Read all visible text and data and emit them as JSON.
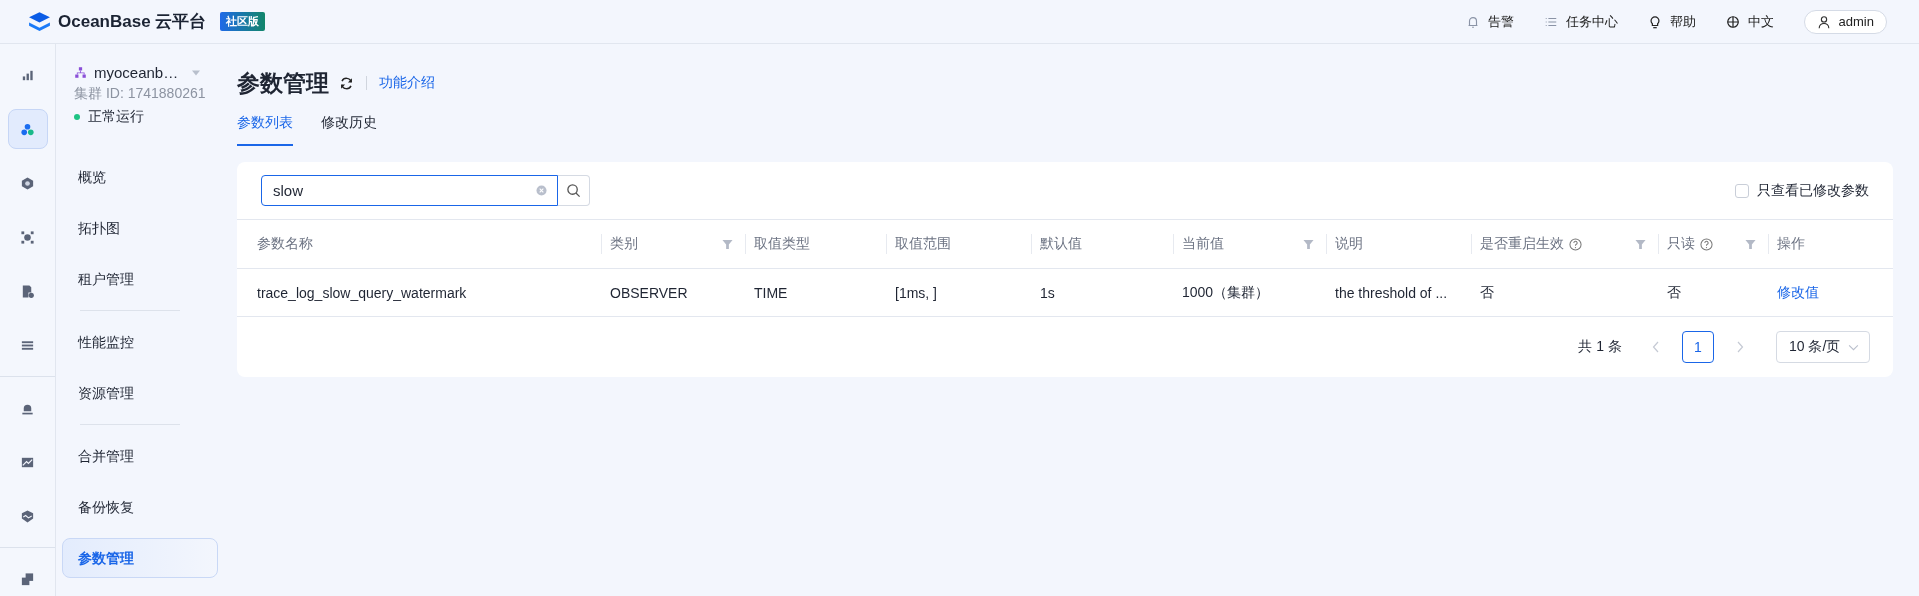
{
  "header": {
    "brand": "OceanBase 云平台",
    "edition": "社区版",
    "actions": [
      {
        "kind": "bell",
        "label": "告警"
      },
      {
        "kind": "list",
        "label": "任务中心"
      },
      {
        "kind": "bulb",
        "label": "帮助"
      },
      {
        "kind": "globe",
        "label": "中文"
      }
    ],
    "user": "admin"
  },
  "rail": [
    {
      "kind": "bars",
      "selected": false,
      "divider_before": false
    },
    {
      "kind": "cluster",
      "selected": true,
      "divider_before": false
    },
    {
      "kind": "hexagon",
      "selected": false,
      "divider_before": false
    },
    {
      "kind": "nodes",
      "selected": false,
      "divider_before": false
    },
    {
      "kind": "doc",
      "selected": false,
      "divider_before": false
    },
    {
      "kind": "lines",
      "selected": false,
      "divider_before": false
    },
    {
      "kind": "alarm",
      "selected": false,
      "divider_before": true
    },
    {
      "kind": "chart",
      "selected": false,
      "divider_before": false
    },
    {
      "kind": "shield",
      "selected": false,
      "divider_before": false
    },
    {
      "kind": "copy",
      "selected": false,
      "divider_before": true
    }
  ],
  "cluster": {
    "name": "myoceanb…",
    "id": "集群 ID: 1741880261",
    "status": "正常运行"
  },
  "sidebar": {
    "items": [
      {
        "label": "概览",
        "selected": false,
        "divider_before": false
      },
      {
        "label": "拓扑图",
        "selected": false,
        "divider_before": false
      },
      {
        "label": "租户管理",
        "selected": false,
        "divider_before": false
      },
      {
        "label": "性能监控",
        "selected": false,
        "divider_before": true
      },
      {
        "label": "资源管理",
        "selected": false,
        "divider_before": false
      },
      {
        "label": "合并管理",
        "selected": false,
        "divider_before": true
      },
      {
        "label": "备份恢复",
        "selected": false,
        "divider_before": false
      },
      {
        "label": "参数管理",
        "selected": true,
        "divider_before": false
      }
    ]
  },
  "page": {
    "title": "参数管理",
    "link": "功能介绍"
  },
  "tabs": [
    {
      "label": "参数列表",
      "selected": true
    },
    {
      "label": "修改历史",
      "selected": false
    }
  ],
  "search": {
    "value": "slow"
  },
  "modified_only": {
    "label": "只查看已修改参数",
    "checked": false
  },
  "table": {
    "columns": [
      {
        "label": "参数名称",
        "filter": false,
        "help": false
      },
      {
        "label": "类别",
        "filter": true,
        "help": false
      },
      {
        "label": "取值类型",
        "filter": false,
        "help": false
      },
      {
        "label": "取值范围",
        "filter": false,
        "help": false
      },
      {
        "label": "默认值",
        "filter": false,
        "help": false
      },
      {
        "label": "当前值",
        "filter": true,
        "help": false
      },
      {
        "label": "说明",
        "filter": false,
        "help": false
      },
      {
        "label": "是否重启生效",
        "filter": true,
        "help": true
      },
      {
        "label": "只读",
        "filter": true,
        "help": true
      },
      {
        "label": "操作",
        "filter": false,
        "help": false
      }
    ],
    "rows": [
      {
        "cells": [
          "trace_log_slow_query_watermark",
          "OBSERVER",
          "TIME",
          "[1ms, ]",
          "1s",
          "1000（集群）",
          "the threshold of ...",
          "否",
          "否"
        ],
        "action": "修改值"
      }
    ]
  },
  "pagination": {
    "total": "共 1 条",
    "pages": [
      {
        "label": "1",
        "selected": true
      }
    ],
    "page_size": "10 条/页"
  }
}
